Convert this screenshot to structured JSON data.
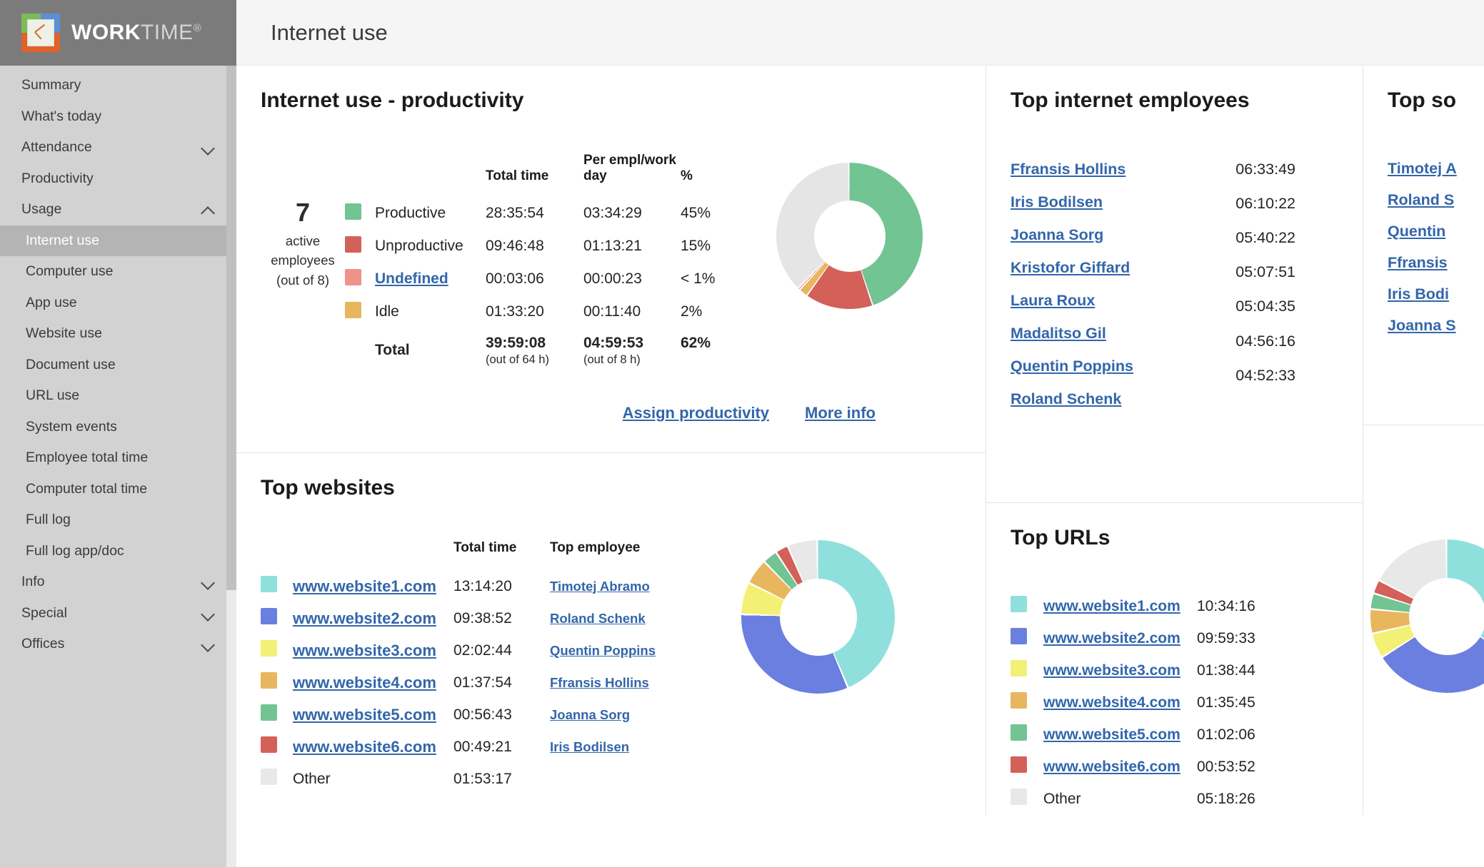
{
  "brand": {
    "word1": "WORK",
    "word2": "TIME",
    "reg": "®"
  },
  "sidebar": {
    "items": [
      {
        "label": "Summary",
        "type": "item"
      },
      {
        "label": "What's today",
        "type": "item"
      },
      {
        "label": "Attendance",
        "type": "group",
        "chev": "chevron-down-icon"
      },
      {
        "label": "Productivity",
        "type": "item"
      },
      {
        "label": "Usage",
        "type": "group",
        "chev": "chevron-up-icon"
      },
      {
        "label": "Internet use",
        "type": "sub",
        "active": true
      },
      {
        "label": "Computer use",
        "type": "sub"
      },
      {
        "label": "App use",
        "type": "sub"
      },
      {
        "label": "Website use",
        "type": "sub"
      },
      {
        "label": "Document use",
        "type": "sub"
      },
      {
        "label": "URL use",
        "type": "sub"
      },
      {
        "label": "System events",
        "type": "sub"
      },
      {
        "label": "Employee total time",
        "type": "sub"
      },
      {
        "label": "Computer total time",
        "type": "sub"
      },
      {
        "label": "Full log",
        "type": "sub"
      },
      {
        "label": "Full log app/doc",
        "type": "sub"
      },
      {
        "label": "Info",
        "type": "group",
        "chev": "chevron-down-icon"
      },
      {
        "label": "Special",
        "type": "group",
        "chev": "chevron-down-icon"
      },
      {
        "label": "Offices",
        "type": "group",
        "chev": "chevron-down-icon"
      }
    ]
  },
  "header": {
    "title": "Internet use"
  },
  "productivity": {
    "title": "Internet use - productivity",
    "active_count": "7",
    "active_label_1": "active",
    "active_label_2": "employees",
    "active_label_3": "(out of 8)",
    "columns": {
      "total_time": "Total time",
      "per_empl": "Per empl/work day",
      "pct": "%"
    },
    "rows": [
      {
        "color": "#72c493",
        "label": "Productive",
        "total": "28:35:54",
        "per": "03:34:29",
        "pct": "45%",
        "link": false
      },
      {
        "color": "#d4605a",
        "label": "Unproductive",
        "total": "09:46:48",
        "per": "01:13:21",
        "pct": "15%",
        "link": false
      },
      {
        "color": "#ef9287",
        "label": "Undefined",
        "total": "00:03:06",
        "per": "00:00:23",
        "pct": "< 1%",
        "link": true
      },
      {
        "color": "#e8b65e",
        "label": "Idle",
        "total": "01:33:20",
        "per": "00:11:40",
        "pct": "2%",
        "link": false
      }
    ],
    "total": {
      "label": "Total",
      "total": "39:59:08",
      "total_sub": "(out of 64 h)",
      "per": "04:59:53",
      "per_sub": "(out of 8 h)",
      "pct": "62%"
    },
    "assign_link": "Assign productivity",
    "more_link": "More info"
  },
  "top_employees": {
    "title": "Top internet employees",
    "rows": [
      {
        "name": "Ffransis Hollins",
        "time": "06:33:49"
      },
      {
        "name": "Iris Bodilsen",
        "time": "06:10:22"
      },
      {
        "name": "Joanna Sorg",
        "time": "05:40:22"
      },
      {
        "name": "Kristofor Giffard",
        "time": "05:07:51"
      },
      {
        "name": "Laura Roux",
        "time": "05:04:35"
      },
      {
        "name": "Madalitso Gil",
        "time": "04:56:16"
      },
      {
        "name": "Quentin Poppins",
        "time": "04:52:33"
      },
      {
        "name": "Roland Schenk",
        "time": ""
      }
    ]
  },
  "top_social": {
    "title": "Top so",
    "rows": [
      {
        "name": "Timotej A"
      },
      {
        "name": "Roland S"
      },
      {
        "name": "Quentin"
      },
      {
        "name": "Ffransis"
      },
      {
        "name": "Iris Bodi"
      },
      {
        "name": "Joanna S"
      }
    ]
  },
  "top_websites": {
    "title": "Top websites",
    "columns": {
      "site": "",
      "total_time": "Total time",
      "top_employee": "Top employee"
    },
    "rows": [
      {
        "color": "#8fe0dd",
        "site": "www.website1.com",
        "time": "13:14:20",
        "employee": "Timotej Abramo"
      },
      {
        "color": "#6b7fe0",
        "site": "www.website2.com",
        "time": "09:38:52",
        "employee": "Roland Schenk"
      },
      {
        "color": "#f2f176",
        "site": "www.website3.com",
        "time": "02:02:44",
        "employee": "Quentin Poppins"
      },
      {
        "color": "#e8b65e",
        "site": "www.website4.com",
        "time": "01:37:54",
        "employee": "Ffransis Hollins"
      },
      {
        "color": "#72c493",
        "site": "www.website5.com",
        "time": "00:56:43",
        "employee": "Joanna Sorg"
      },
      {
        "color": "#d4605a",
        "site": "www.website6.com",
        "time": "00:49:21",
        "employee": "Iris Bodilsen"
      },
      {
        "color": "#e8e8e8",
        "site": "Other",
        "time": "01:53:17",
        "employee": ""
      }
    ]
  },
  "top_urls": {
    "title": "Top URLs",
    "rows": [
      {
        "color": "#8fe0dd",
        "site": "www.website1.com",
        "time": "10:34:16"
      },
      {
        "color": "#6b7fe0",
        "site": "www.website2.com",
        "time": "09:59:33"
      },
      {
        "color": "#f2f176",
        "site": "www.website3.com",
        "time": "01:38:44"
      },
      {
        "color": "#e8b65e",
        "site": "www.website4.com",
        "time": "01:35:45"
      },
      {
        "color": "#72c493",
        "site": "www.website5.com",
        "time": "01:02:06"
      },
      {
        "color": "#d4605a",
        "site": "www.website6.com",
        "time": "00:53:52"
      },
      {
        "color": "#e8e8e8",
        "site": "Other",
        "time": "05:18:26"
      }
    ]
  },
  "chart_data": [
    {
      "type": "pie",
      "title": "Internet use - productivity",
      "labels": [
        "Productive",
        "Unproductive",
        "Idle",
        "Undefined",
        "Remaining"
      ],
      "values": [
        45,
        15,
        2,
        0.5,
        37.5
      ],
      "colors": [
        "#72c493",
        "#d4605a",
        "#e8b65e",
        "#ef9287",
        "#e5e5e5"
      ],
      "donut": true
    },
    {
      "type": "pie",
      "title": "Top websites",
      "labels": [
        "www.website1.com",
        "www.website2.com",
        "www.website3.com",
        "www.website4.com",
        "www.website5.com",
        "www.website6.com",
        "Other"
      ],
      "values": [
        13.239,
        9.648,
        2.046,
        1.632,
        0.945,
        0.823,
        1.888
      ],
      "colors": [
        "#8fe0dd",
        "#6b7fe0",
        "#f2f176",
        "#e8b65e",
        "#72c493",
        "#d4605a",
        "#e8e8e8"
      ],
      "donut": true
    },
    {
      "type": "pie",
      "title": "Top URLs",
      "labels": [
        "www.website1.com",
        "www.website2.com",
        "www.website3.com",
        "www.website4.com",
        "www.website5.com",
        "www.website6.com",
        "Other"
      ],
      "values": [
        10.571,
        9.992,
        1.645,
        1.596,
        1.035,
        0.898,
        5.307
      ],
      "colors": [
        "#8fe0dd",
        "#6b7fe0",
        "#f2f176",
        "#e8b65e",
        "#72c493",
        "#d4605a",
        "#e8e8e8"
      ],
      "donut": true
    }
  ]
}
